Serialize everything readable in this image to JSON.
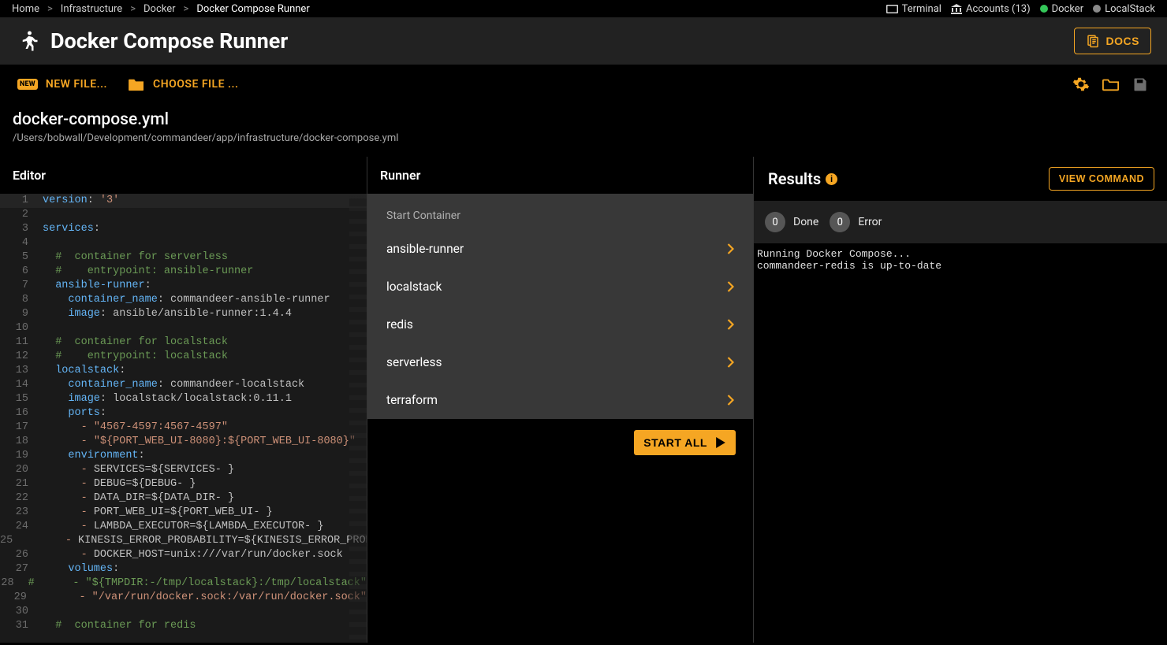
{
  "breadcrumbs": [
    "Home",
    "Infrastructure",
    "Docker",
    "Docker Compose Runner"
  ],
  "status": {
    "terminal": "Terminal",
    "accounts": "Accounts (13)",
    "docker": "Docker",
    "localstack": "LocalStack"
  },
  "header": {
    "title": "Docker Compose Runner",
    "docs": "DOCS"
  },
  "toolbar": {
    "new_file": "NEW FILE...",
    "choose_file": "CHOOSE FILE ..."
  },
  "file": {
    "name": "docker-compose.yml",
    "path": "/Users/bobwall/Development/commandeer/app/infrastructure/docker-compose.yml"
  },
  "editor": {
    "title": "Editor",
    "lines": [
      {
        "n": 1,
        "i": 0,
        "t": [
          [
            "key",
            "version"
          ],
          [
            "punc",
            ": "
          ],
          [
            "str",
            "'3'"
          ]
        ]
      },
      {
        "n": 2,
        "i": 0,
        "t": []
      },
      {
        "n": 3,
        "i": 0,
        "t": [
          [
            "key",
            "services"
          ],
          [
            "punc",
            ":"
          ]
        ]
      },
      {
        "n": 4,
        "i": 0,
        "t": []
      },
      {
        "n": 5,
        "i": 1,
        "t": [
          [
            "cmt",
            "#  container for serverless"
          ]
        ]
      },
      {
        "n": 6,
        "i": 1,
        "t": [
          [
            "cmt",
            "#    entrypoint: ansible-runner"
          ]
        ]
      },
      {
        "n": 7,
        "i": 1,
        "t": [
          [
            "key",
            "ansible-runner"
          ],
          [
            "punc",
            ":"
          ]
        ]
      },
      {
        "n": 8,
        "i": 2,
        "t": [
          [
            "key",
            "container_name"
          ],
          [
            "punc",
            ": "
          ],
          [
            "txt",
            "commandeer-ansible-runner"
          ]
        ]
      },
      {
        "n": 9,
        "i": 2,
        "t": [
          [
            "key",
            "image"
          ],
          [
            "punc",
            ": "
          ],
          [
            "txt",
            "ansible/ansible-runner:1.4.4"
          ]
        ]
      },
      {
        "n": 10,
        "i": 0,
        "t": []
      },
      {
        "n": 11,
        "i": 1,
        "t": [
          [
            "cmt",
            "#  container for localstack"
          ]
        ]
      },
      {
        "n": 12,
        "i": 1,
        "t": [
          [
            "cmt",
            "#    entrypoint: localstack"
          ]
        ]
      },
      {
        "n": 13,
        "i": 1,
        "t": [
          [
            "key",
            "localstack"
          ],
          [
            "punc",
            ":"
          ]
        ]
      },
      {
        "n": 14,
        "i": 2,
        "t": [
          [
            "key",
            "container_name"
          ],
          [
            "punc",
            ": "
          ],
          [
            "txt",
            "commandeer-localstack"
          ]
        ]
      },
      {
        "n": 15,
        "i": 2,
        "t": [
          [
            "key",
            "image"
          ],
          [
            "punc",
            ": "
          ],
          [
            "txt",
            "localstack/localstack:0.11.1"
          ]
        ]
      },
      {
        "n": 16,
        "i": 2,
        "t": [
          [
            "key",
            "ports"
          ],
          [
            "punc",
            ":"
          ]
        ]
      },
      {
        "n": 17,
        "i": 3,
        "t": [
          [
            "dash",
            "- "
          ],
          [
            "str",
            "\"4567-4597:4567-4597\""
          ]
        ]
      },
      {
        "n": 18,
        "i": 3,
        "t": [
          [
            "dash",
            "- "
          ],
          [
            "str",
            "\"${PORT_WEB_UI-8080}:${PORT_WEB_UI-8080}\""
          ]
        ]
      },
      {
        "n": 19,
        "i": 2,
        "t": [
          [
            "key",
            "environment"
          ],
          [
            "punc",
            ":"
          ]
        ]
      },
      {
        "n": 20,
        "i": 3,
        "t": [
          [
            "dash",
            "- "
          ],
          [
            "txt",
            "SERVICES=${SERVICES- }"
          ]
        ]
      },
      {
        "n": 21,
        "i": 3,
        "t": [
          [
            "dash",
            "- "
          ],
          [
            "txt",
            "DEBUG=${DEBUG- }"
          ]
        ]
      },
      {
        "n": 22,
        "i": 3,
        "t": [
          [
            "dash",
            "- "
          ],
          [
            "txt",
            "DATA_DIR=${DATA_DIR- }"
          ]
        ]
      },
      {
        "n": 23,
        "i": 3,
        "t": [
          [
            "dash",
            "- "
          ],
          [
            "txt",
            "PORT_WEB_UI=${PORT_WEB_UI- }"
          ]
        ]
      },
      {
        "n": 24,
        "i": 3,
        "t": [
          [
            "dash",
            "- "
          ],
          [
            "txt",
            "LAMBDA_EXECUTOR=${LAMBDA_EXECUTOR- }"
          ]
        ]
      },
      {
        "n": 25,
        "i": 3,
        "t": [
          [
            "dash",
            "- "
          ],
          [
            "txt",
            "KINESIS_ERROR_PROBABILITY=${KINESIS_ERROR_PROBA"
          ]
        ]
      },
      {
        "n": 26,
        "i": 3,
        "t": [
          [
            "dash",
            "- "
          ],
          [
            "txt",
            "DOCKER_HOST=unix:///var/run/docker.sock"
          ]
        ]
      },
      {
        "n": 27,
        "i": 2,
        "t": [
          [
            "key",
            "volumes"
          ],
          [
            "punc",
            ":"
          ]
        ]
      },
      {
        "n": 28,
        "i": 0,
        "t": [
          [
            "cmt",
            "#      - \"${TMPDIR:-/tmp/localstack}:/tmp/localstack\""
          ]
        ]
      },
      {
        "n": 29,
        "i": 3,
        "t": [
          [
            "dash",
            "- "
          ],
          [
            "str",
            "\"/var/run/docker.sock:/var/run/docker.sock\""
          ]
        ]
      },
      {
        "n": 30,
        "i": 0,
        "t": []
      },
      {
        "n": 31,
        "i": 1,
        "t": [
          [
            "cmt",
            "#  container for redis"
          ]
        ]
      }
    ]
  },
  "runner": {
    "title": "Runner",
    "start_label": "Start Container",
    "items": [
      "ansible-runner",
      "localstack",
      "redis",
      "serverless",
      "terraform"
    ],
    "start_all": "START ALL"
  },
  "results": {
    "title": "Results",
    "view_command": "VIEW COMMAND",
    "done": {
      "count": "0",
      "label": "Done"
    },
    "error": {
      "count": "0",
      "label": "Error"
    },
    "output": "Running Docker Compose...\ncommandeer-redis is up-to-date"
  }
}
